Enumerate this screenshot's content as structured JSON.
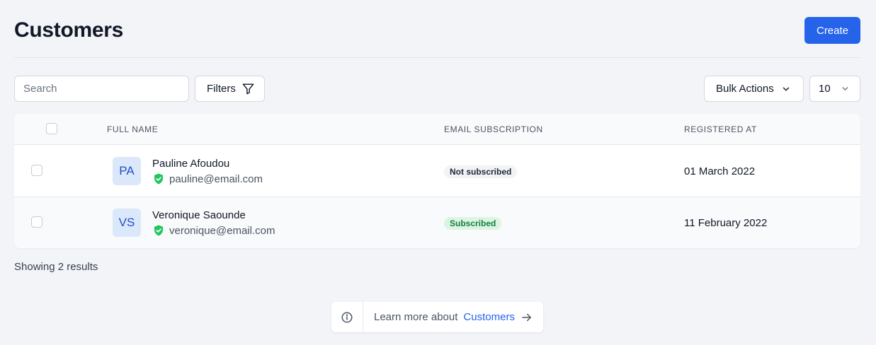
{
  "header": {
    "title": "Customers",
    "create_label": "Create"
  },
  "toolbar": {
    "search_placeholder": "Search",
    "filters_label": "Filters",
    "bulk_actions_label": "Bulk Actions",
    "per_page_value": "10"
  },
  "table": {
    "columns": [
      "Full Name",
      "Email Subscription",
      "Registered At"
    ],
    "rows": [
      {
        "initials": "PA",
        "name": "Pauline Afoudou",
        "email": "pauline@email.com",
        "subscription": "Not subscribed",
        "registered_at": "01 March 2022"
      },
      {
        "initials": "VS",
        "name": "Veronique Saounde",
        "email": "veronique@email.com",
        "subscription": "Subscribed",
        "registered_at": "11 February 2022"
      }
    ]
  },
  "footer": {
    "results_text": "Showing 2 results",
    "learn_more_text": "Learn more about",
    "learn_more_link": "Customers"
  },
  "colors": {
    "accent": "#2563eb",
    "verified": "#22c55e",
    "subscribed_bg": "#dcf5e3",
    "subscribed_text": "#15803d"
  },
  "icons": {
    "filter": "funnel-icon",
    "bulk_chevron": "chevron-down-icon",
    "per_page_chevron": "chevron-down-icon",
    "verified": "shield-check-icon",
    "info": "info-circle-icon",
    "arrow": "arrow-right-icon"
  }
}
